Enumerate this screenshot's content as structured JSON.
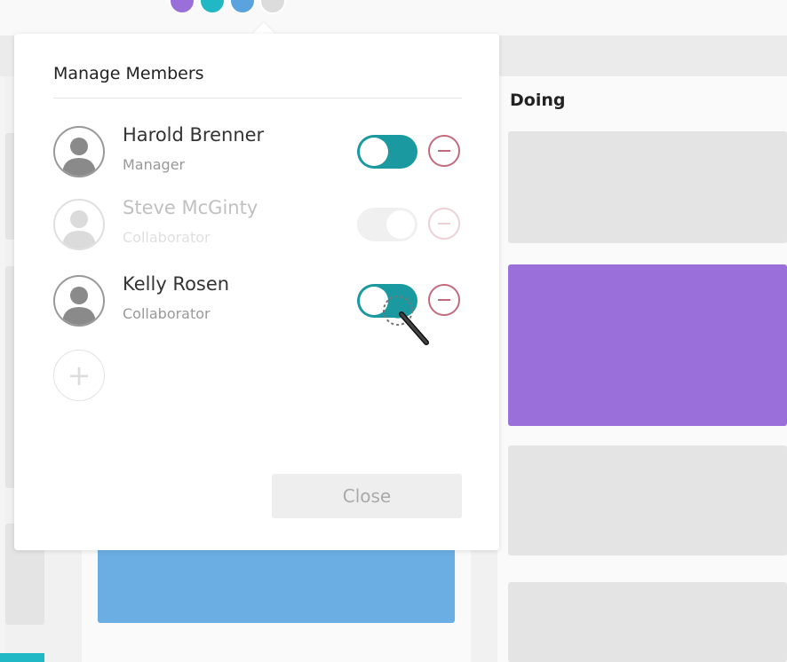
{
  "board": {
    "avatar_colors": [
      "#9b6fd9",
      "#1fb8c4",
      "#5aa3de",
      "#dcdcdc"
    ],
    "columns": [
      {
        "title": "Doing"
      }
    ],
    "card_colors": {
      "purple": "#9b6fd9",
      "blue": "#6aaee3",
      "grey": "#e4e4e4"
    }
  },
  "manage_members": {
    "title": "Manage Members",
    "members": [
      {
        "name": "Harold Brenner",
        "role": "Manager",
        "enabled": true
      },
      {
        "name": "Steve McGinty",
        "role": "Collaborator",
        "enabled": false
      },
      {
        "name": "Kelly Rosen",
        "role": "Collaborator",
        "enabled": true
      }
    ],
    "add_icon": "plus-icon",
    "remove_icon": "minus-circle-icon",
    "close_label": "Close"
  },
  "colors": {
    "toggle_on": "#1a9aa0",
    "toggle_off": "#cfcfcf",
    "remove": "#c46a7d"
  }
}
